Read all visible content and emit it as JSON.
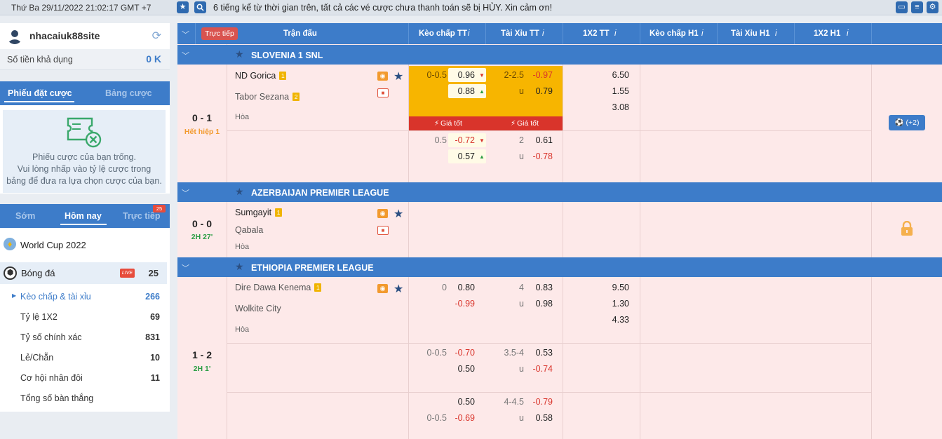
{
  "topbar": {
    "datetime": "Thứ Ba 29/11/2022 21:02:17 GMT +7",
    "notice": "6 tiếng kể từ thời gian trên, tất cả các vé cược chưa thanh toán sẽ bị HỦY. Xin cảm ơn!"
  },
  "user": {
    "name": "nhacaiuk88site",
    "balance_label": "Số tiền khả dụng",
    "balance_value": "0 K"
  },
  "betslip": {
    "tab_active": "Phiếu đặt cược",
    "tab_other": "Bảng cược",
    "empty_line1": "Phiếu cược của bạn trống.",
    "empty_line2": "Vui lòng nhấp vào tỷ lệ cược trong",
    "empty_line3": "bảng để đưa ra lựa chọn cược của bạn."
  },
  "period_tabs": {
    "early": "Sớm",
    "today": "Hôm nay",
    "live": "Trực tiếp",
    "live_count": "25"
  },
  "sports": {
    "worldcup": "World Cup 2022",
    "football": "Bóng đá",
    "live_badge": "LIVE",
    "football_count": "25",
    "items": [
      {
        "label": "Kèo chấp & tài xỉu",
        "count": "266"
      },
      {
        "label": "Tỷ lệ 1X2",
        "count": "69"
      },
      {
        "label": "Tỷ số chính xác",
        "count": "831"
      },
      {
        "label": "Lẻ/Chẵn",
        "count": "10"
      },
      {
        "label": "Cơ hội nhân đôi",
        "count": "11"
      },
      {
        "label": "Tổng số bàn thắng",
        "count": ""
      }
    ]
  },
  "header": {
    "live": "Trực tiếp",
    "match": "Trận đấu",
    "hdp_ft": "Kèo chấp TT",
    "ou_ft": "Tài Xỉu TT",
    "x12_ft": "1X2 TT",
    "hdp_h1": "Kèo chấp H1",
    "ou_h1": "Tài Xỉu H1",
    "x12_h1": "1X2 H1",
    "info": "i"
  },
  "leagues": [
    {
      "name": "SLOVENIA 1 SNL",
      "score": "0 - 1",
      "period": "Hết hiệp 1",
      "home": "ND Gorica",
      "away": "Tabor Sezana",
      "home_badge": "1",
      "away_badge": "2",
      "draw": "Hòa",
      "best_price": "Giá tốt",
      "more": "(+2)",
      "rows": [
        {
          "hdp": "0-0.5",
          "h1": "0.96",
          "h2": "0.88",
          "ou": "2-2.5",
          "o1": "-0.97",
          "u_lbl": "u",
          "o2": "0.79",
          "x1": "6.50",
          "x2": "1.55",
          "x3": "3.08"
        },
        {
          "hdp": "0.5",
          "h1": "-0.72",
          "h2": "0.57",
          "ou": "2",
          "o1": "0.61",
          "u_lbl": "u",
          "o2": "-0.78"
        }
      ]
    },
    {
      "name": "AZERBAIJAN PREMIER LEAGUE",
      "score": "0 - 0",
      "period": "2H 27'",
      "home": "Sumgayit",
      "away": "Qabala",
      "home_badge": "1",
      "draw": "Hòa"
    },
    {
      "name": "ETHIOPIA PREMIER LEAGUE",
      "score": "1 - 2",
      "period": "2H 1'",
      "home": "Dire Dawa Kenema",
      "away": "Wolkite City",
      "home_badge": "1",
      "draw": "Hòa",
      "rows": [
        {
          "hdp": "0",
          "h1": "0.80",
          "h2": "-0.99",
          "ou": "4",
          "o1": "0.83",
          "u_lbl": "u",
          "o2": "0.98",
          "x1": "9.50",
          "x2": "1.30",
          "x3": "4.33"
        },
        {
          "hdp": "0-0.5",
          "h1": "-0.70",
          "h2": "0.50",
          "ou": "3.5-4",
          "o1": "0.53",
          "u_lbl": "u",
          "o2": "-0.74"
        },
        {
          "hdp2": "0-0.5",
          "h1": "0.50",
          "h2": "-0.69",
          "ou": "4-4.5",
          "o1": "-0.79",
          "u_lbl": "u",
          "o2": "0.58"
        }
      ]
    }
  ],
  "colors": {
    "primary": "#3d7cc9",
    "row_bg": "#fde9e9",
    "gold": "#f7b500",
    "negative": "#d9342b"
  }
}
